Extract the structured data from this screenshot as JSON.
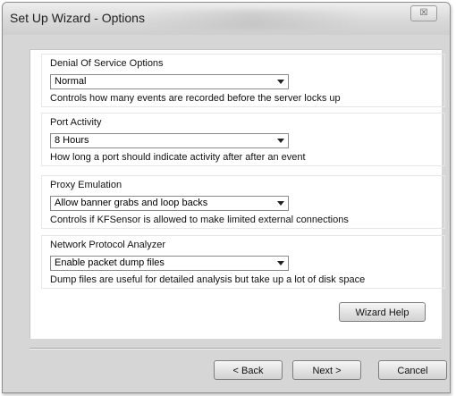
{
  "window": {
    "title": "Set Up Wizard - Options",
    "close_glyph": "☒"
  },
  "groups": [
    {
      "label": "Denial Of Service Options",
      "value": "Normal",
      "description": "Controls how many events are recorded before the server locks up"
    },
    {
      "label": "Port Activity",
      "value": "8 Hours",
      "description": "How long a port should indicate activity after after an event"
    },
    {
      "label": "Proxy Emulation",
      "value": "Allow banner grabs and loop backs",
      "description": "Controls if KFSensor is allowed to make limited external connections"
    },
    {
      "label": "Network Protocol Analyzer",
      "value": "Enable packet dump files",
      "description": "Dump files are useful for detailed analysis but take up a lot of disk space"
    }
  ],
  "buttons": {
    "help": "Wizard Help",
    "back": "< Back",
    "next": "Next >",
    "cancel": "Cancel"
  }
}
